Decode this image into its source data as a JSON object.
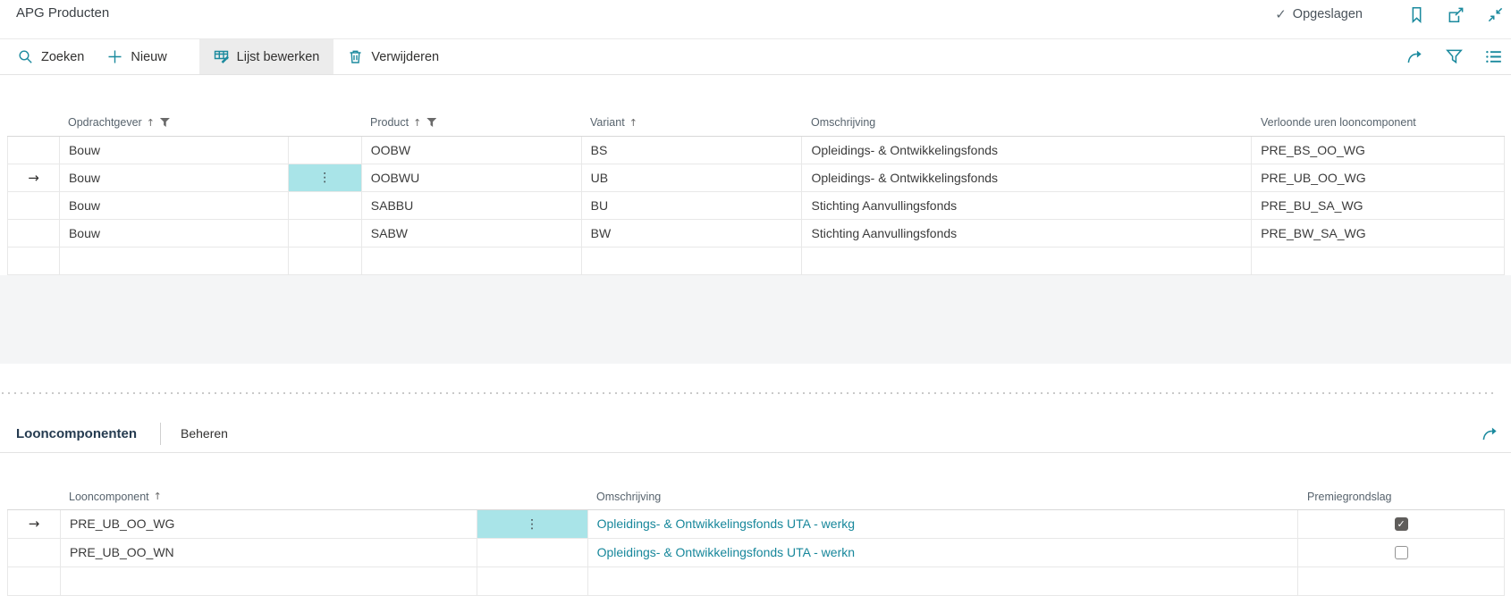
{
  "page": {
    "title": "APG Producten",
    "status": "Opgeslagen"
  },
  "title_icons": [
    "bookmark-icon",
    "open-in-new-window-icon",
    "collapse-icon"
  ],
  "toolbar": {
    "search_label": "Zoeken",
    "new_label": "Nieuw",
    "edit_list_label": "Lijst bewerken",
    "delete_label": "Verwijderen",
    "right_icons": [
      "share-icon",
      "filter-icon",
      "options-icon"
    ]
  },
  "products_table": {
    "columns": {
      "opdrachtgever": "Opdrachtgever",
      "product": "Product",
      "variant": "Variant",
      "omschrijving": "Omschrijving",
      "verloonde": "Verloonde uren looncomponent"
    },
    "sorted_columns": [
      "Opdrachtgever",
      "Product",
      "Variant"
    ],
    "filtered_columns": [
      "Opdrachtgever",
      "Product"
    ],
    "rows": [
      {
        "active": false,
        "opdrachtgever": "Bouw",
        "product": "OOBW",
        "variant": "BS",
        "omschrijving": "Opleidings- & Ontwikkelingsfonds",
        "verloonde": "PRE_BS_OO_WG"
      },
      {
        "active": true,
        "opdrachtgever": "Bouw",
        "product": "OOBWU",
        "variant": "UB",
        "omschrijving": "Opleidings- & Ontwikkelingsfonds",
        "verloonde": "PRE_UB_OO_WG"
      },
      {
        "active": false,
        "opdrachtgever": "Bouw",
        "product": "SABBU",
        "variant": "BU",
        "omschrijving": "Stichting Aanvullingsfonds",
        "verloonde": "PRE_BU_SA_WG"
      },
      {
        "active": false,
        "opdrachtgever": "Bouw",
        "product": "SABW",
        "variant": "BW",
        "omschrijving": "Stichting Aanvullingsfonds",
        "verloonde": "PRE_BW_SA_WG"
      }
    ]
  },
  "subpage": {
    "title": "Looncomponenten",
    "manage_label": "Beheren",
    "columns": {
      "looncomponent": "Looncomponent",
      "omschrijving": "Omschrijving",
      "premiegrondslag": "Premiegrondslag"
    },
    "sorted_columns": [
      "Looncomponent"
    ],
    "rows": [
      {
        "active": true,
        "looncomponent": "PRE_UB_OO_WG",
        "omschrijving": "Opleidings- & Ontwikkelingsfonds UTA - werkg",
        "premiegrondslag": true
      },
      {
        "active": false,
        "looncomponent": "PRE_UB_OO_WN",
        "omschrijving": "Opleidings- & Ontwikkelingsfonds UTA - werkn",
        "premiegrondslag": false
      }
    ]
  },
  "colors": {
    "accent_teal": "#1b8a9e",
    "link_teal": "#17879b",
    "active_cell_highlight": "#a9e4e8",
    "gray_band": "#f4f5f6",
    "checkbox_checked": "#5f5d5b",
    "text": "#323130",
    "header_text": "#57636d"
  }
}
